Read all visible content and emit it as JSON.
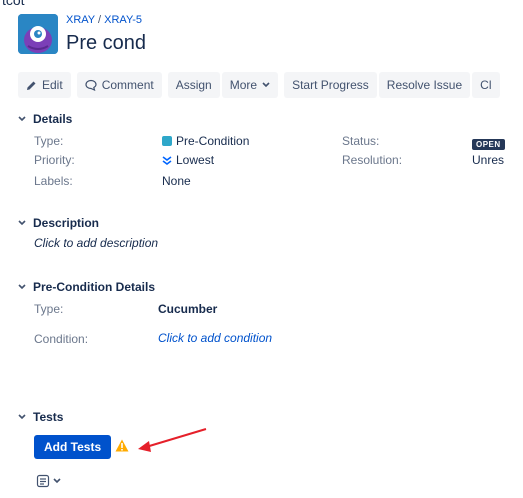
{
  "page": {
    "fragment_text": "tcot"
  },
  "breadcrumb": {
    "project": "XRAY",
    "separator": "/",
    "issue_key": "XRAY-5"
  },
  "issue": {
    "title": "Pre cond"
  },
  "toolbar": {
    "edit": "Edit",
    "comment": "Comment",
    "assign": "Assign",
    "more": "More",
    "start_progress": "Start Progress",
    "resolve": "Resolve Issue",
    "close_partial": "Cl"
  },
  "details": {
    "heading": "Details",
    "type_label": "Type:",
    "type_value": "Pre-Condition",
    "priority_label": "Priority:",
    "priority_value": "Lowest",
    "labels_label": "Labels:",
    "labels_value": "None",
    "status_label": "Status:",
    "status_value": "OPEN",
    "resolution_label": "Resolution:",
    "resolution_value": "Unres"
  },
  "description": {
    "heading": "Description",
    "placeholder": "Click to add description"
  },
  "precondition": {
    "heading": "Pre-Condition Details",
    "type_label": "Type:",
    "type_value": "Cucumber",
    "condition_label": "Condition:",
    "condition_value": "Click to add condition"
  },
  "tests": {
    "heading": "Tests",
    "add_button": "Add Tests",
    "warning_icon": "warning-icon"
  },
  "colors": {
    "primary": "#0052cc",
    "link": "#0052cc",
    "warning": "#ffab00",
    "annotation": "#e5202a"
  }
}
